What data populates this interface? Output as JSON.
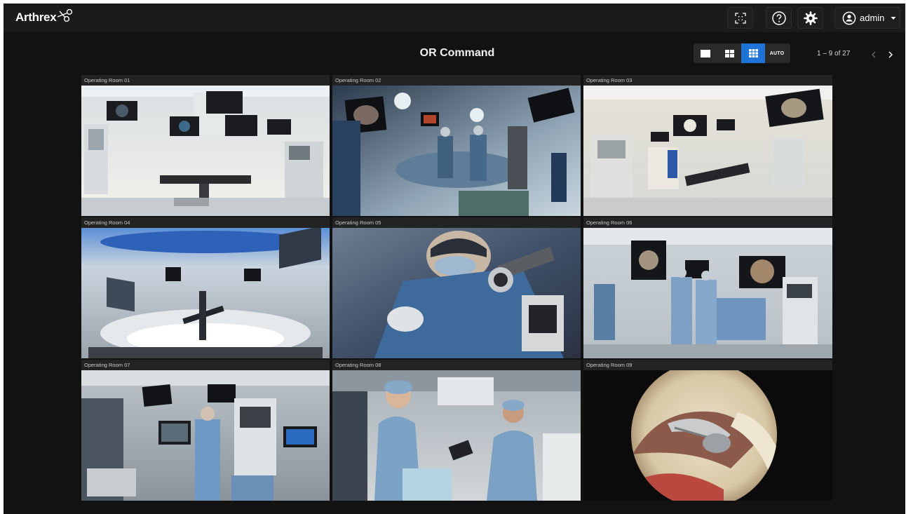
{
  "app": {
    "brand": "Arthrex",
    "page_title": "OR Command"
  },
  "topbar": {
    "fullscreen_icon": "fullscreen-icon",
    "help_icon": "help-icon",
    "settings_icon": "gear-icon",
    "user_icon": "user-circle-icon",
    "user_name": "admin"
  },
  "layout_options": [
    {
      "id": "single",
      "icon": "single-view-icon",
      "active": false
    },
    {
      "id": "quad",
      "icon": "quad-view-icon",
      "active": false
    },
    {
      "id": "grid9",
      "icon": "nine-grid-view-icon",
      "active": true
    },
    {
      "id": "auto",
      "label": "AUTO",
      "active": false
    }
  ],
  "pagination": {
    "text": "1 – 9 of 27"
  },
  "rooms": [
    {
      "label": "Operating Room 01",
      "scene": "or-room-bright"
    },
    {
      "label": "Operating Room 02",
      "scene": "or-surgery-blue"
    },
    {
      "label": "Operating Room 03",
      "scene": "or-room-bright"
    },
    {
      "label": "Operating Room 04",
      "scene": "or-room-blue-ceiling"
    },
    {
      "label": "Operating Room 05",
      "scene": "surgeon-closeup"
    },
    {
      "label": "Operating Room 06",
      "scene": "or-surgery-team"
    },
    {
      "label": "Operating Room 07",
      "scene": "or-4k-touchscreen"
    },
    {
      "label": "Operating Room 08",
      "scene": "surgeons-tablet"
    },
    {
      "label": "Operating Room 09",
      "scene": "arthroscopic-view"
    }
  ],
  "colors": {
    "accent": "#1e74d6",
    "background": "#121212",
    "topbar": "#1b1b1b"
  }
}
